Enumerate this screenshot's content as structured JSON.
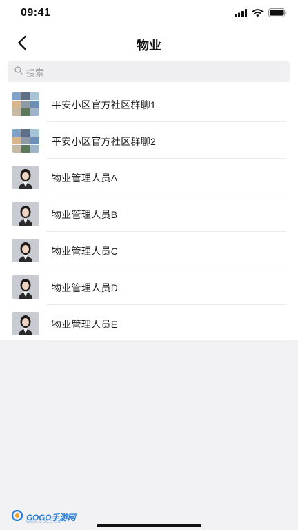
{
  "status_bar": {
    "time": "09:41",
    "icons": [
      "signal-icon",
      "wifi-icon",
      "battery-icon"
    ]
  },
  "nav": {
    "back_icon": "chevron-left-icon",
    "title": "物业"
  },
  "search": {
    "icon": "search-icon",
    "placeholder": "搜索"
  },
  "contacts": [
    {
      "label": "平安小区官方社区群聊1",
      "avatar": "group-avatar"
    },
    {
      "label": "平安小区官方社区群聊2",
      "avatar": "group-avatar"
    },
    {
      "label": "物业管理人员A",
      "avatar": "person-avatar"
    },
    {
      "label": "物业管理人员B",
      "avatar": "person-avatar"
    },
    {
      "label": "物业管理人员C",
      "avatar": "person-avatar"
    },
    {
      "label": "物业管理人员D",
      "avatar": "person-avatar"
    },
    {
      "label": "物业管理人员E",
      "avatar": "person-avatar"
    }
  ],
  "watermark": {
    "brand": "GOGO手游网",
    "site": "WWW.GOGO.CN"
  },
  "colors": {
    "page_background": "#f2f2f5",
    "list_background": "#ffffff",
    "search_background": "#f0f0f2",
    "divider": "#ececee",
    "watermark_blue": "#2b7fd9"
  }
}
